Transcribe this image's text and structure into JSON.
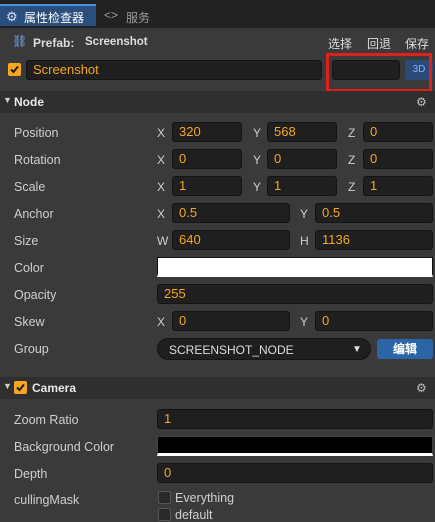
{
  "tabs": {
    "active_label": "属性检查器",
    "inactive_label": "服务"
  },
  "prefab": {
    "prefix": "Prefab:",
    "name": "Screenshot",
    "actions": [
      "选择",
      "回退",
      "保存"
    ]
  },
  "node_name": "Screenshot",
  "btn_3d": "3D",
  "sections": {
    "node": "Node",
    "camera": "Camera"
  },
  "props": {
    "position": {
      "label": "Position",
      "x": "320",
      "y": "568",
      "z": "0"
    },
    "rotation": {
      "label": "Rotation",
      "x": "0",
      "y": "0",
      "z": "0"
    },
    "scale": {
      "label": "Scale",
      "x": "1",
      "y": "1",
      "z": "1"
    },
    "anchor": {
      "label": "Anchor",
      "x": "0.5",
      "y": "0.5"
    },
    "size": {
      "label": "Size",
      "w": "640",
      "h": "1136"
    },
    "color": {
      "label": "Color",
      "value": "#ffffff"
    },
    "opacity": {
      "label": "Opacity",
      "value": "255"
    },
    "skew": {
      "label": "Skew",
      "x": "0",
      "y": "0"
    },
    "group": {
      "label": "Group",
      "value": "SCREENSHOT_NODE",
      "edit": "编辑"
    }
  },
  "axes": {
    "x": "X",
    "y": "Y",
    "z": "Z",
    "w": "W",
    "h": "H"
  },
  "camera": {
    "zoom": {
      "label": "Zoom Ratio",
      "value": "1"
    },
    "bg": {
      "label": "Background Color",
      "value": "#000000"
    },
    "depth": {
      "label": "Depth",
      "value": "0"
    },
    "culling": {
      "label": "cullingMask",
      "options": [
        "Everything",
        "default"
      ]
    }
  },
  "colors": {
    "accent": "#f5a623",
    "highlight_box": "#e0201c",
    "blue": "#2c65a6"
  }
}
